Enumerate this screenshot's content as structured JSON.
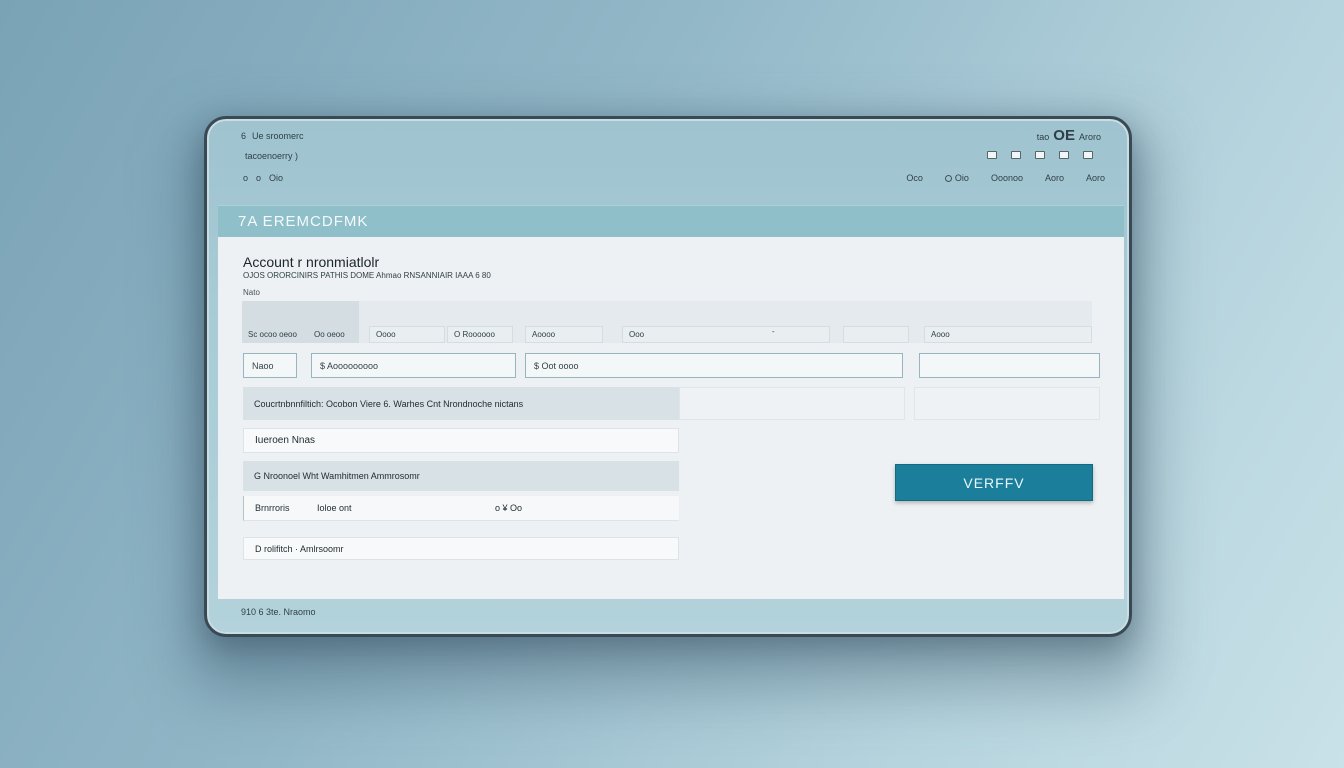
{
  "topbar": {
    "row1_icon": "6",
    "row1_text": "Ue sroomerc",
    "row2_text": "tacoenoerry )",
    "row3_icons": [
      "o",
      "o"
    ],
    "row3_text": "Oio",
    "right1_small_left": "tao",
    "right1_big": "OE",
    "right1_small_right": "Aroro",
    "right3_items": [
      "Oco",
      "Oio",
      "Ooonoo",
      "Aoro",
      "Aoro"
    ]
  },
  "brand": {
    "title": "7A EREMCDFMK"
  },
  "form": {
    "title": "Account r nronmiatlolr",
    "subtitle": "OJOS ORORCINIRS PATHIS DOME Ahmao RNSANNIAIR IAAA 6 80",
    "label": "Nato",
    "tabs": [
      "Sc ocoo oeoo",
      "Oo oeoo",
      "Oooo",
      "O Roooooo",
      "Aoooo",
      "Ooo",
      "-",
      "Aooo"
    ],
    "field_name": "Naoo",
    "field_1": "$  Aooooooooo",
    "field_2": "$  Oot  oooo",
    "field_3": "",
    "row_header": "Coucrtnbnnfiltich: Ocobon Viere 6. Warhes Cnt Nrondnoche nictans",
    "row_name": "Iueroen Nnas",
    "row_section": "G Nroonoel Wht Wamhitmen Ammrosomr",
    "row_detail_label": "Brnrroris",
    "row_detail_value": "Ioloe ont",
    "row_detail_right": "o  ¥  Oo",
    "row_footer": "D rolifitch  ·  Amlrsoomr"
  },
  "actions": {
    "verify_label": "VERFFV"
  },
  "footer": {
    "text": "910 6   3te.  Nraomo"
  }
}
